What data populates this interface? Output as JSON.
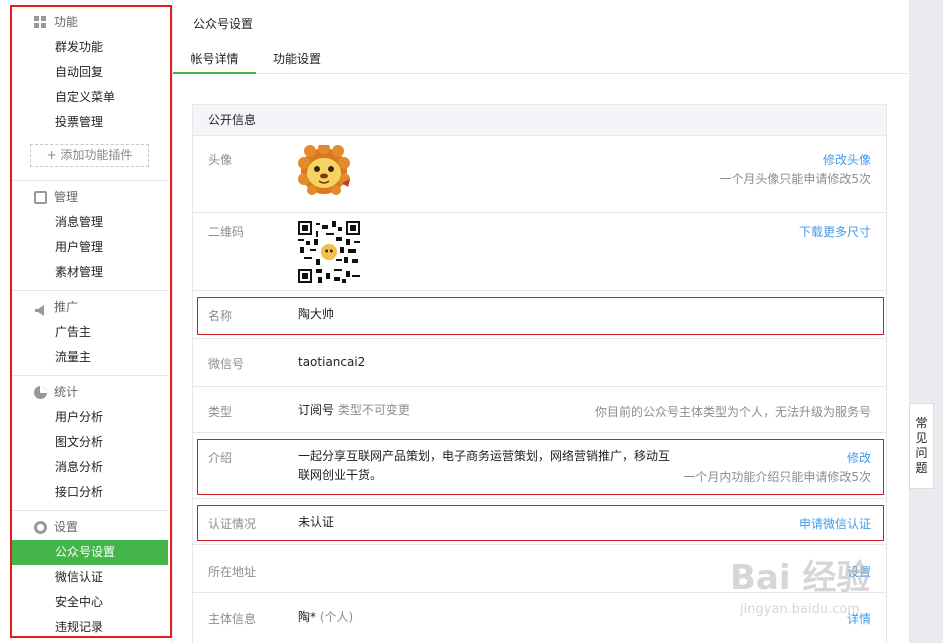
{
  "sidebar": {
    "groups": [
      {
        "title": "功能",
        "icon": "grid-icon",
        "items": [
          "群发功能",
          "自动回复",
          "自定义菜单",
          "投票管理"
        ],
        "plugin": "+ 添加功能插件"
      },
      {
        "title": "管理",
        "icon": "inbox-icon",
        "items": [
          "消息管理",
          "用户管理",
          "素材管理"
        ]
      },
      {
        "title": "推广",
        "icon": "megaphone-icon",
        "items": [
          "广告主",
          "流量主"
        ]
      },
      {
        "title": "统计",
        "icon": "pie-chart-icon",
        "items": [
          "用户分析",
          "图文分析",
          "消息分析",
          "接口分析"
        ]
      },
      {
        "title": "设置",
        "icon": "gear-icon",
        "items": [
          "公众号设置",
          "微信认证",
          "安全中心",
          "违规记录"
        ],
        "active": "公众号设置"
      }
    ]
  },
  "main": {
    "title": "公众号设置",
    "tabs": [
      {
        "label": "帐号详情",
        "active": true
      },
      {
        "label": "功能设置",
        "active": false
      }
    ],
    "card": {
      "header": "公开信息",
      "rows": {
        "avatar": {
          "label": "头像",
          "link": "修改头像",
          "note": "一个月头像只能申请修改5次"
        },
        "qrcode": {
          "label": "二维码",
          "link": "下载更多尺寸"
        },
        "name": {
          "label": "名称",
          "value": "陶大帅"
        },
        "wechat_id": {
          "label": "微信号",
          "value": "taotiancai2"
        },
        "type": {
          "label": "类型",
          "value": "订阅号",
          "sub": "类型不可变更",
          "note": "你目前的公众号主体类型为个人，无法升级为服务号"
        },
        "intro": {
          "label": "介绍",
          "value_line1": "一起分享互联网产品策划，电子商务运营策划，网络营销推广，移动互",
          "value_line2": "联网创业干货。",
          "link": "修改",
          "note": "一个月内功能介绍只能申请修改5次"
        },
        "verify": {
          "label": "认证情况",
          "value": "未认证",
          "link": "申请微信认证"
        },
        "address": {
          "label": "所在地址",
          "link": "设置"
        },
        "entity": {
          "label": "主体信息",
          "value": "陶*",
          "sub": "(个人)",
          "link": "详情"
        }
      }
    }
  },
  "faq": {
    "chars": [
      "常",
      "见",
      "问",
      "题"
    ]
  },
  "watermark": {
    "brand": "Bai 经验",
    "url": "jingyan.baidu.com"
  },
  "colors": {
    "accent_green": "#44b549",
    "link_blue": "#459ae9",
    "highlight_red": "#e31c1c"
  }
}
